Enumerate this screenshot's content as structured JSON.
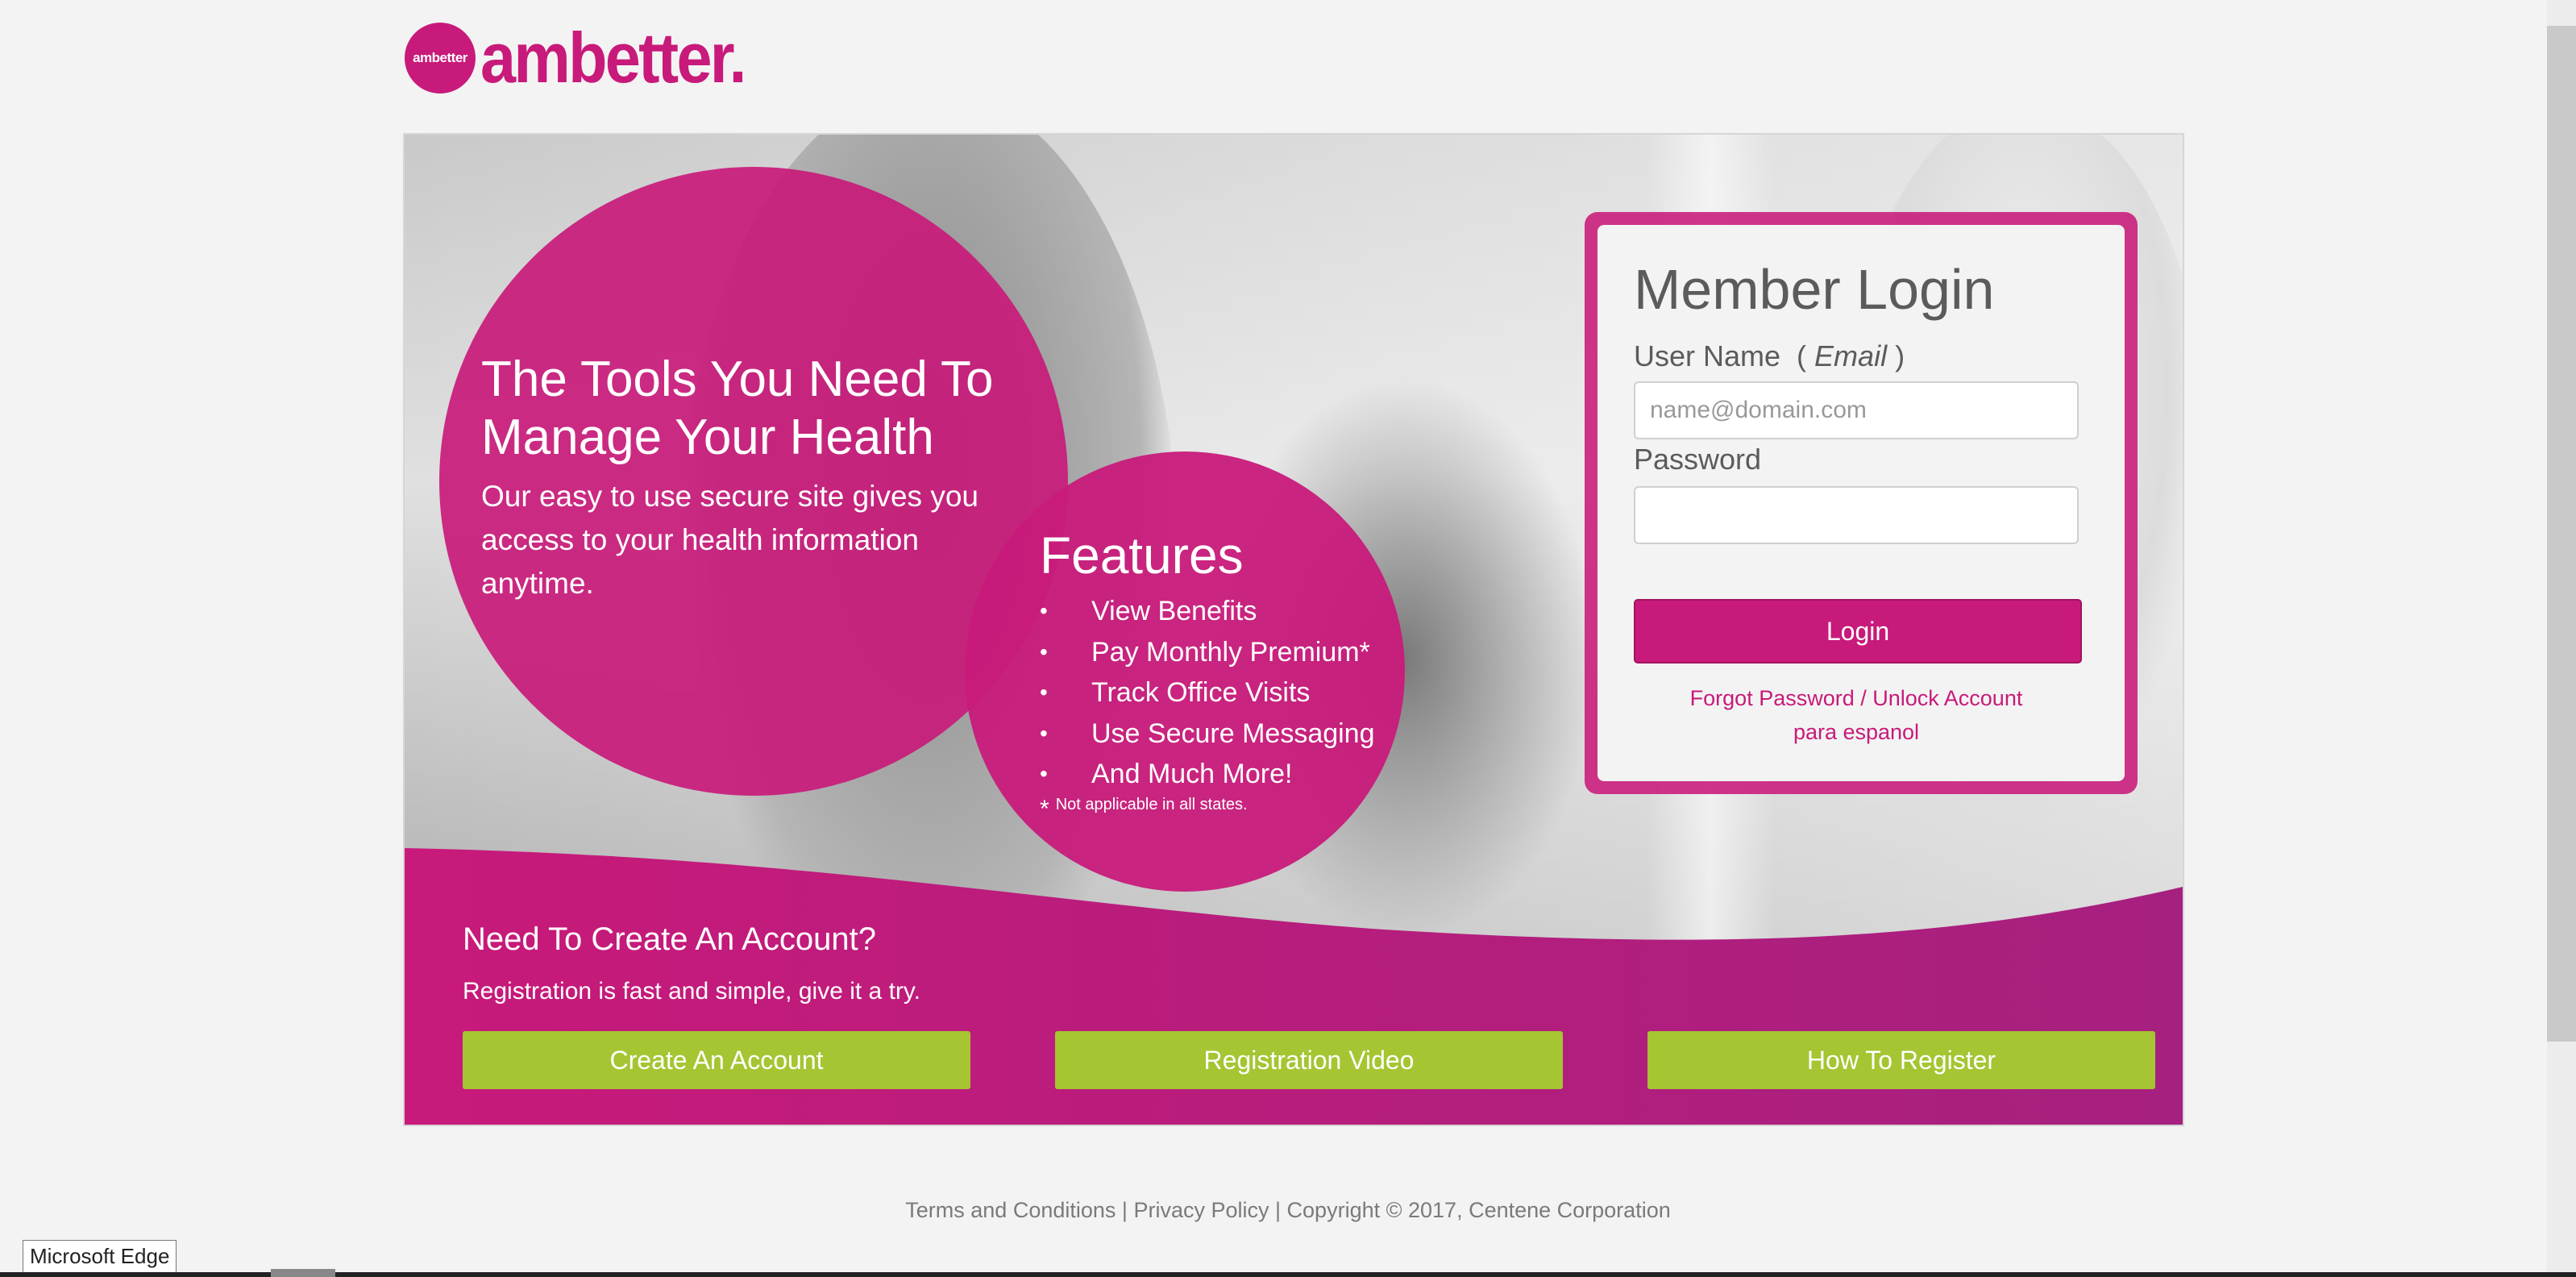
{
  "brand": {
    "logo_circle_text": "ambetter",
    "logo_word": "ambetter.",
    "accent_color": "#c81a7a",
    "button_green": "#a5c532"
  },
  "hero": {
    "headline": "The Tools You Need To Manage Your Health",
    "subline": "Our easy to use secure site gives you access to your health information anytime.",
    "features_title": "Features",
    "features": [
      "View Benefits",
      "Pay Monthly Premium*",
      "Track Office Visits",
      "Use Secure Messaging",
      "And Much More!"
    ],
    "footnote_star": "*",
    "footnote": "Not applicable in all states."
  },
  "login": {
    "title": "Member Login",
    "username_label": "User Name",
    "username_hint": "Email",
    "username_placeholder": "name@domain.com",
    "username_value": "",
    "password_label": "Password",
    "password_value": "",
    "login_button": "Login",
    "forgot_link": "Forgot Password / Unlock Account",
    "spanish_link": "para espanol"
  },
  "create_account": {
    "title": "Need To Create An Account?",
    "subtitle": "Registration is fast and simple, give it a try.",
    "buttons": [
      "Create An Account",
      "Registration Video",
      "How To Register"
    ]
  },
  "footer": {
    "terms": "Terms and Conditions",
    "separator": "|",
    "privacy": "Privacy Policy",
    "copyright": "Copyright © 2017, Centene Corporation"
  },
  "tooltip": "Microsoft Edge"
}
